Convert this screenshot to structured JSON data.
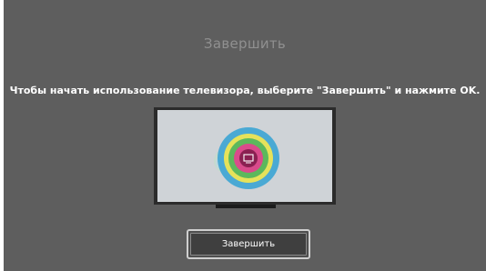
{
  "screen": {
    "title": "Завершить",
    "instruction": "Чтобы начать использование телевизора, выберите \"Завершить\" и нажмите OK.",
    "illustration": {
      "icon": "tv-target-icon",
      "colors": {
        "tv_bezel": "#2b2b2b",
        "tv_screen": "#d0d4d8",
        "ring_outer": "#4aa9d4",
        "ring_yellow": "#e6e25a",
        "ring_green": "#5cb85c",
        "ring_pink": "#d94b8b",
        "center": "#8a2051"
      }
    },
    "finish_button": {
      "label": "Завершить"
    }
  },
  "colors": {
    "background": "#5e5e5e",
    "title_text": "#909090",
    "body_text": "#ffffff",
    "button_border": "#cfcfcf"
  }
}
